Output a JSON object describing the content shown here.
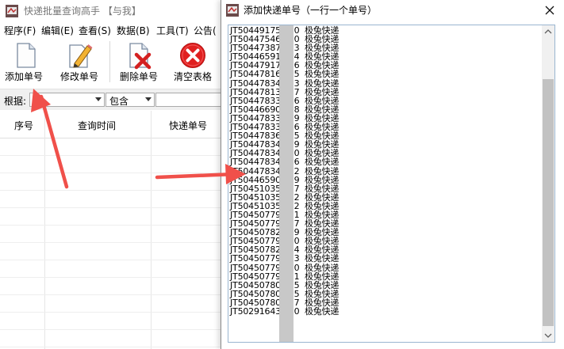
{
  "main_window": {
    "title": "快递批量查询高手 【与我】",
    "menu": [
      "程序(F)",
      "编辑(E)",
      "查看(S)",
      "数据(B)",
      "工具(T)",
      "公告("
    ],
    "toolbar": {
      "add_label": "添加单号",
      "edit_label": "修改单号",
      "delete_label": "删除单号",
      "clear_label": "清空表格"
    },
    "filter": {
      "label": "根据:",
      "field_value": "",
      "condition_value": "包含"
    },
    "table_headers": [
      "序号",
      "查询时间",
      "快递单号"
    ]
  },
  "dialog": {
    "title": "添加快递单号（一行一个单号）",
    "lines": [
      "JT504491753   0  极兔快递",
      "JT504475466   0  极兔快递",
      "JT504473874   3  极兔快递",
      "JT504465912   4  极兔快递",
      "JT504479171   6  极兔快递",
      "JT504478160   5  极兔快递",
      "JT504478340   3  极兔快递",
      "JT504478130   7  极兔快递",
      "JT504478335   6  极兔快递",
      "JT504466905   8  极兔快递",
      "JT504478335   9  极兔快递",
      "JT504478339   6  极兔快递",
      "JT504478362   5  极兔快递",
      "JT504478344   9  极兔快递",
      "JT504478344   0  极兔快递",
      "JT504478344   6  极兔快递",
      "JT504478344   2  极兔快递",
      "JT504465909   9  极兔快递",
      "JT504510357   7  极兔快递",
      "JT504510357   2  极兔快递",
      "JT504510357   2  极兔快递",
      "JT504507796   1  极兔快递",
      "JT504507799   7  极兔快递",
      "JT504507822   9  极兔快递",
      "JT504507792   0  极兔快递",
      "JT504507822   4  极兔快递",
      "JT504507798   3  极兔快递",
      "JT504507794   0  极兔快递",
      "JT504507796   1  极兔快递",
      "JT504507801   5  极兔快递",
      "JT504507801   5  极兔快递",
      "JT504507801   7  极兔快递",
      "JT502916430   0  极兔快递"
    ]
  },
  "icons": {
    "add": "document-icon",
    "edit": "pencil-document-icon",
    "delete": "delete-document-icon",
    "clear": "red-x-circle-icon",
    "close": "close-icon"
  },
  "colors": {
    "annotation_arrow": "#f0504a",
    "clear_red": "#e02020",
    "delete_red": "#d42020",
    "scroll_thumb": "#c2c2c2"
  }
}
